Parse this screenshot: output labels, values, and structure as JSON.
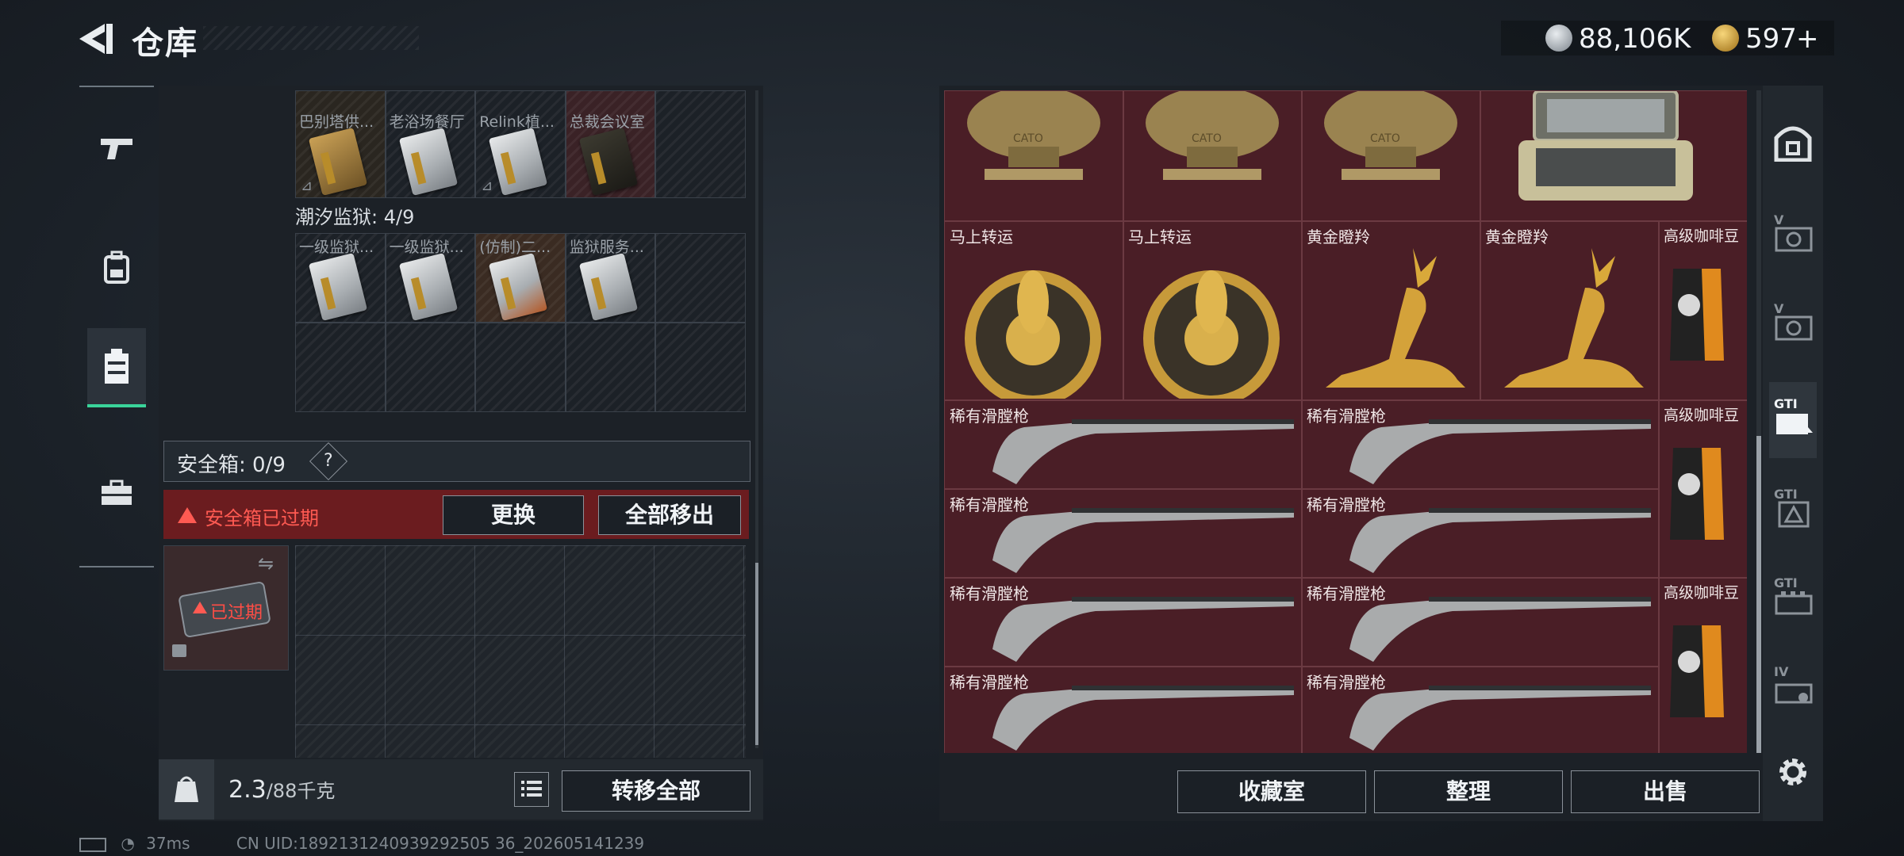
{
  "header": {
    "title": "仓库",
    "currency": [
      {
        "icon": "silver-coin-icon",
        "value": "88,106K",
        "color": "#c0c6cc"
      },
      {
        "icon": "gold-coin-icon",
        "value": "597",
        "plus": "+",
        "color": "#d6a640"
      }
    ]
  },
  "left_nav": [
    {
      "icon": "pistol-icon",
      "active": false
    },
    {
      "icon": "backpack-icon",
      "active": false
    },
    {
      "icon": "storage-box-icon",
      "active": true
    },
    {
      "icon": "toolbox-icon",
      "active": false
    }
  ],
  "upper_slots": [
    {
      "name": "巴别塔供...",
      "card_color": "#a27a36"
    },
    {
      "name": "老浴场餐厅",
      "card_color": "#aab0b5"
    },
    {
      "name": "Relink植...",
      "card_color": "#b8bcc0"
    },
    {
      "name": "总裁会议室",
      "card_color": "#3b3a2f"
    }
  ],
  "prison": {
    "label": "潮汐监狱: 4/9",
    "slots": [
      {
        "name": "一级监狱...",
        "card_color": "#b89328"
      },
      {
        "name": "一级监狱...",
        "card_color": "#c49a34"
      },
      {
        "name": "(仿制)二...",
        "card_color": "#b35a2a"
      },
      {
        "name": "监狱服务...",
        "card_color": "#9aa2aa"
      }
    ]
  },
  "safe_box": {
    "label": "安全箱: 0/9",
    "help": "?",
    "expired_text": "安全箱已过期",
    "replace_label": "更换",
    "remove_all_label": "全部移出",
    "item_status": "已过期"
  },
  "weight": {
    "current": "2.3",
    "capacity": "/88千克"
  },
  "transfer_all_label": "转移全部",
  "vault": {
    "row0": [
      {
        "name": "",
        "type": "bust",
        "label": "CATO"
      },
      {
        "name": "",
        "type": "bust",
        "label": "CATO"
      },
      {
        "name": "",
        "type": "bust",
        "label": "CATO"
      },
      {
        "name": "",
        "type": "case"
      }
    ],
    "row1": [
      {
        "name": "马上转运",
        "type": "wheel"
      },
      {
        "name": "马上转运",
        "type": "wheel"
      },
      {
        "name": "黄金瞪羚",
        "type": "deer"
      },
      {
        "name": "黄金瞪羚",
        "type": "deer"
      },
      {
        "name": "高级咖啡豆",
        "type": "coffee"
      }
    ],
    "muskets": [
      {
        "name": "稀有滑膛枪"
      },
      {
        "name": "稀有滑膛枪"
      },
      {
        "name": "稀有滑膛枪"
      },
      {
        "name": "稀有滑膛枪"
      },
      {
        "name": "稀有滑膛枪"
      },
      {
        "name": "稀有滑膛枪"
      },
      {
        "name": "稀有滑膛枪"
      },
      {
        "name": "稀有滑膛枪"
      }
    ],
    "coffee_side": [
      {
        "name": "高级咖啡豆"
      },
      {
        "name": "高级咖啡豆"
      }
    ]
  },
  "category_nav": [
    {
      "icon": "vault-door-icon",
      "active": false
    },
    {
      "icon": "category-v-icon",
      "label": "V",
      "active": false
    },
    {
      "icon": "category-v-icon",
      "label": "V",
      "active": false
    },
    {
      "icon": "category-gti-icon",
      "label": "GTI",
      "active": true
    },
    {
      "icon": "category-gti-icon",
      "label": "GTI",
      "active": false
    },
    {
      "icon": "category-gti-icon",
      "label": "GTI",
      "active": false
    },
    {
      "icon": "category-iv-icon",
      "label": "IV",
      "active": false
    },
    {
      "icon": "settings-gear-icon",
      "active": false
    }
  ],
  "bottom_buttons": {
    "collection": "收藏室",
    "organize": "整理",
    "sell": "出售"
  },
  "status": {
    "ping": "37ms",
    "uid": "CN UID:1892131240939292505 36_202605141239"
  }
}
